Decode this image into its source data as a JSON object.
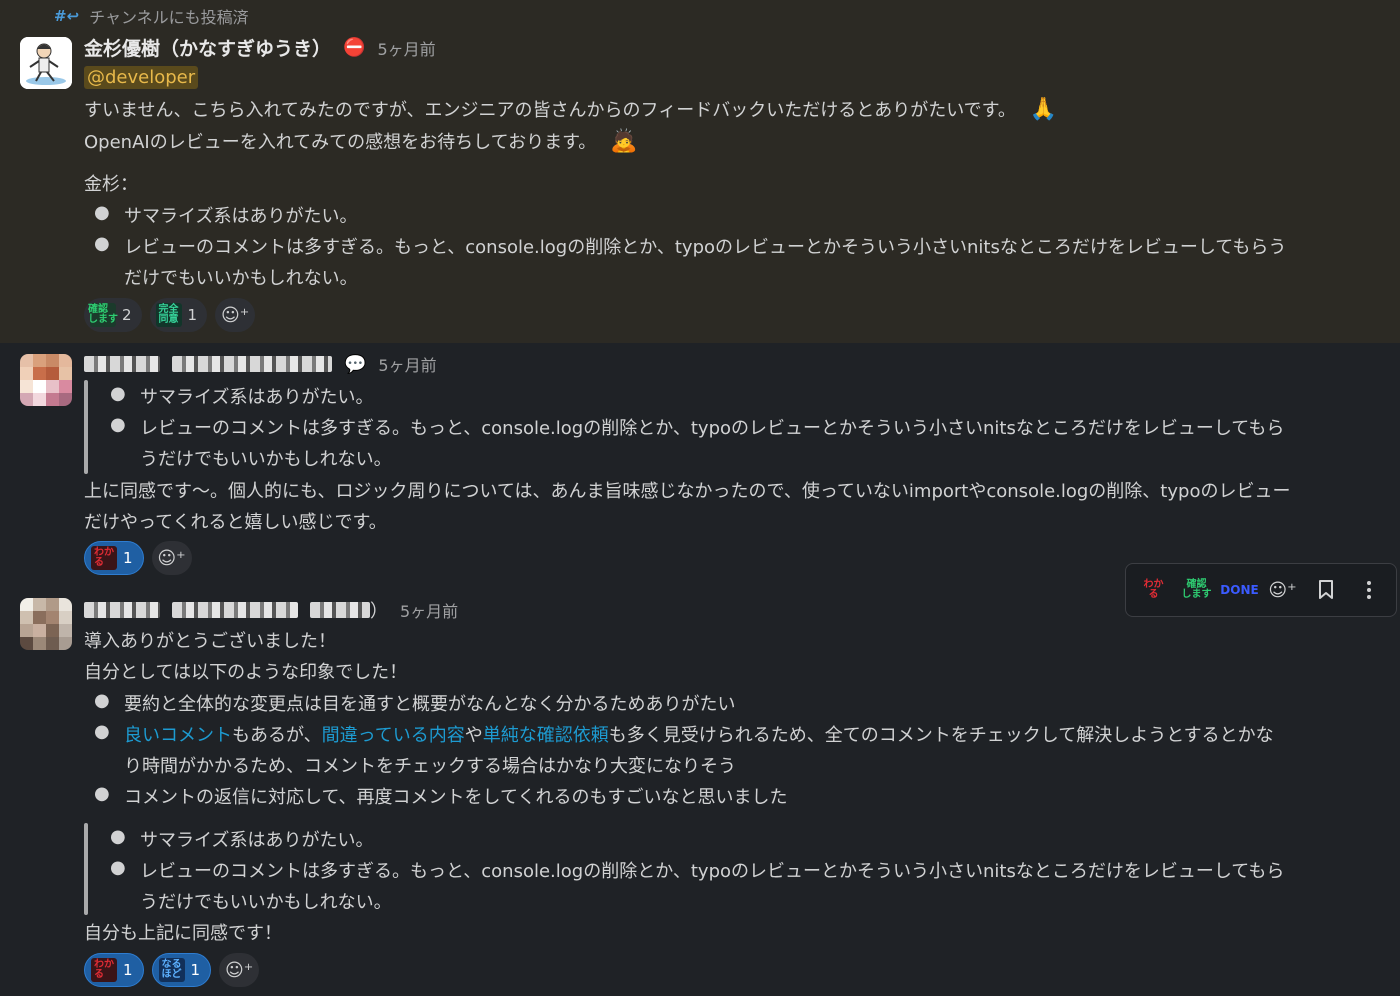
{
  "thread": {
    "shared_note": "チャンネルにも投稿済",
    "messages": [
      {
        "author": "金杉優樹（かなすぎゆうき）",
        "status_emoji": "⛔",
        "time": "5ヶ月前",
        "mention": "@developer",
        "lines": [
          "すいません、こちら入れてみたのですが、エンジニアの皆さんからのフィードバックいただけるとありがたいです。",
          "OpenAIのレビューを入れてみての感想をお待ちしております。",
          "金杉："
        ],
        "bullets": [
          "サマライズ系はありがたい。",
          "レビューのコメントは多すぎる。もっと、console.logの削除とか、typoのレビューとかそういう小さいnitsなところだけをレビューしてもらう",
          "だけでもいいかもしれない。"
        ],
        "emoji_pray": "🙏",
        "emoji_bow": "🙇",
        "reactions": [
          {
            "label": "確認します",
            "count": "2",
            "icon": "kakunin-icon"
          },
          {
            "label": "完全同意",
            "count": "1",
            "icon": "kanzen-douI-icon"
          }
        ]
      },
      {
        "time": "5ヶ月前",
        "status_emoji": "💬",
        "quote": [
          "サマライズ系はありがたい。",
          "レビューのコメントは多すぎる。もっと、console.logの削除とか、typoのレビューとかそういう小さいnitsなところだけをレビューしてもら",
          "うだけでもいいかもしれない。"
        ],
        "lines": [
          "上に同感です〜。個人的にも、ロジック周りについては、あんま旨味感じなかったので、使っていないimportやconsole.logの削除、typoのレビュー",
          "だけやってくれると嬉しい感じです。"
        ],
        "reactions": [
          {
            "label": "わかる",
            "count": "1",
            "icon": "wakaru-icon"
          }
        ]
      },
      {
        "time": "5ヶ月前",
        "name_suffix": "）",
        "lines": [
          "導入ありがとうございました！",
          "自分としては以下のような印象でした！"
        ],
        "bullets": [
          "要約と全体的な変更点は目を通すと概要がなんとなく分かるためありがたい",
          "り時間がかかるため、コメントをチェックする場合はかなり大変になりそう",
          "コメントの返信に対応して、再度コメントをしてくれるのもすごいなと思いました"
        ],
        "bullet2_parts": {
          "link1": "良いコメント",
          "t1": "もあるが、",
          "link2": "間違っている内容",
          "t2": "や",
          "link3": "単純な確認依頼",
          "t3": "も多く見受けられるため、全てのコメントをチェックして解決しようとするとかな"
        },
        "quote": [
          "サマライズ系はありがたい。",
          "レビューのコメントは多すぎる。もっと、console.logの削除とか、typoのレビューとかそういう小さいnitsなところだけをレビューしてもら",
          "うだけでもいいかもしれない。"
        ],
        "closing": "自分も上記に同感です！",
        "reactions": [
          {
            "label": "わかる",
            "count": "1",
            "icon": "wakaru-icon"
          },
          {
            "label": "なるほど",
            "count": "1",
            "icon": "naruhodo-icon"
          }
        ]
      }
    ]
  },
  "toolbar": {
    "items": [
      "わかる",
      "確認します",
      "DONE",
      "add-reaction",
      "bookmark",
      "more"
    ]
  },
  "emoji_text": {
    "kakunin": "確認\nします",
    "kanzen": "完全\n同意",
    "wakaru": "わか\nる",
    "naruhodo": "なる\nほど",
    "done": "DONE"
  },
  "colors": {
    "highlight_bg": "#2c2a24",
    "mention_fg": "#e8b94a",
    "link": "#1d9bd1",
    "reaction_mine": "#1f5fa3"
  }
}
